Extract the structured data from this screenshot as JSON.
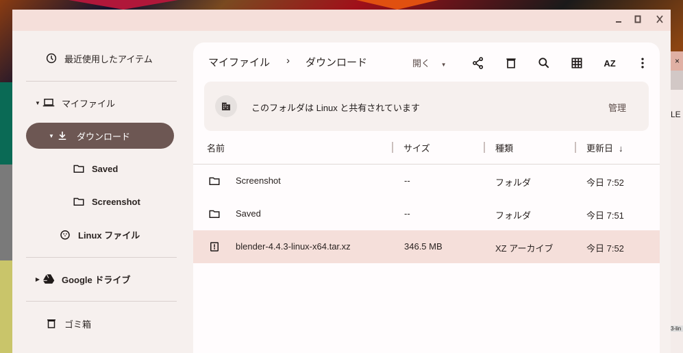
{
  "window": {
    "minimize_icon": "minimize-icon",
    "maximize_icon": "maximize-icon",
    "close_icon": "close-icon"
  },
  "sidebar": {
    "recent": "最近使用したアイテム",
    "my_files": "マイファイル",
    "downloads": "ダウンロード",
    "saved": "Saved",
    "screenshot": "Screenshot",
    "linux_files": "Linux ファイル",
    "google_drive": "Google ドライブ",
    "trash": "ゴミ箱"
  },
  "toolbar": {
    "breadcrumb": [
      "マイファイル",
      "ダウンロード"
    ],
    "breadcrumb_sep": "›",
    "open_label": "開く",
    "sort_label": "AZ"
  },
  "banner": {
    "text": "このフォルダは Linux と共有されています",
    "action": "管理"
  },
  "table": {
    "headers": [
      "名前",
      "サイズ",
      "種類",
      "更新日"
    ],
    "rows": [
      {
        "name": "Screenshot",
        "size": "--",
        "type": "フォルダ",
        "modified": "今日 7:52",
        "icon": "folder-icon",
        "selected": false
      },
      {
        "name": "Saved",
        "size": "--",
        "type": "フォルダ",
        "modified": "今日 7:51",
        "icon": "folder-icon",
        "selected": false
      },
      {
        "name": "blender-4.4.3-linux-x64.tar.xz",
        "size": "346.5 MB",
        "type": "XZ アーカイブ",
        "modified": "今日 7:52",
        "icon": "archive-icon",
        "selected": true
      }
    ]
  },
  "background_window": {
    "label": "LE",
    "close": "×",
    "tab": "3-lin"
  },
  "colors": {
    "titlebar": "#f5dfda",
    "selected_nav": "#6d5753",
    "selected_row": "#f5dfda",
    "panel": "#f6f0ee"
  }
}
